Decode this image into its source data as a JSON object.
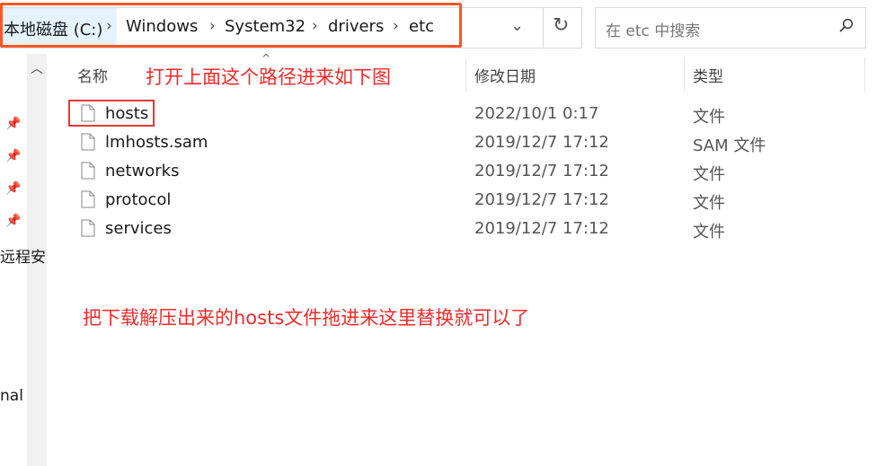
{
  "address_bar": {
    "crumbs": [
      "本地磁盘 (C:)",
      "Windows",
      "System32",
      "drivers",
      "etc"
    ],
    "separator": ">"
  },
  "search": {
    "placeholder": "在 etc 中搜索"
  },
  "nav_pane": {
    "fragments": [
      "远程安",
      "nal"
    ]
  },
  "columns": [
    "名称",
    "修改日期",
    "类型"
  ],
  "files": [
    {
      "name": "hosts",
      "modified": "2022/10/1 0:17",
      "type": "文件"
    },
    {
      "name": "lmhosts.sam",
      "modified": "2019/12/7 17:12",
      "type": "SAM 文件"
    },
    {
      "name": "networks",
      "modified": "2019/12/7 17:12",
      "type": "文件"
    },
    {
      "name": "protocol",
      "modified": "2019/12/7 17:12",
      "type": "文件"
    },
    {
      "name": "services",
      "modified": "2019/12/7 17:12",
      "type": "文件"
    }
  ],
  "annotations": {
    "path_note": "打开上面这个路径进来如下图",
    "replace_note": "把下载解压出来的hosts文件拖进来这里替换就可以了"
  },
  "colors": {
    "annotation": "#f02b2b",
    "path_highlight": "#ff5722",
    "crumb_selected_bg": "#e5f3ff"
  }
}
